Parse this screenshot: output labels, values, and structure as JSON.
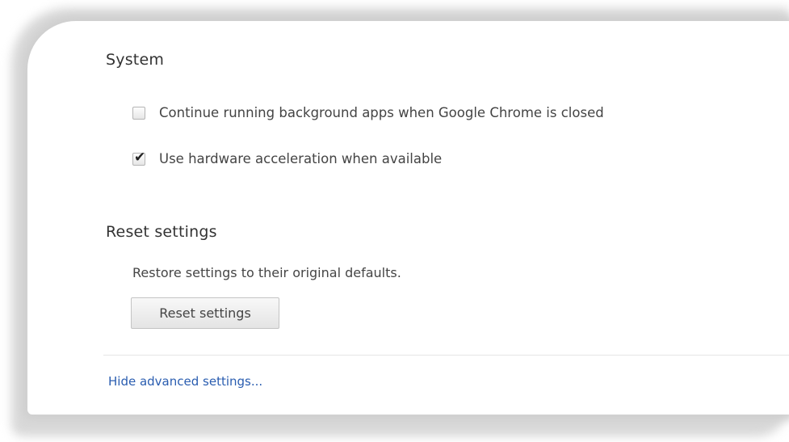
{
  "system": {
    "title": "System",
    "options": [
      {
        "label": "Continue running background apps when Google Chrome is closed",
        "checked": false
      },
      {
        "label": "Use hardware acceleration when available",
        "checked": true
      }
    ]
  },
  "reset": {
    "title": "Reset settings",
    "description": "Restore settings to their original defaults.",
    "button_label": "Reset settings"
  },
  "footer": {
    "link_label": "Hide advanced settings..."
  },
  "icons": {
    "checkmark": "✔"
  }
}
